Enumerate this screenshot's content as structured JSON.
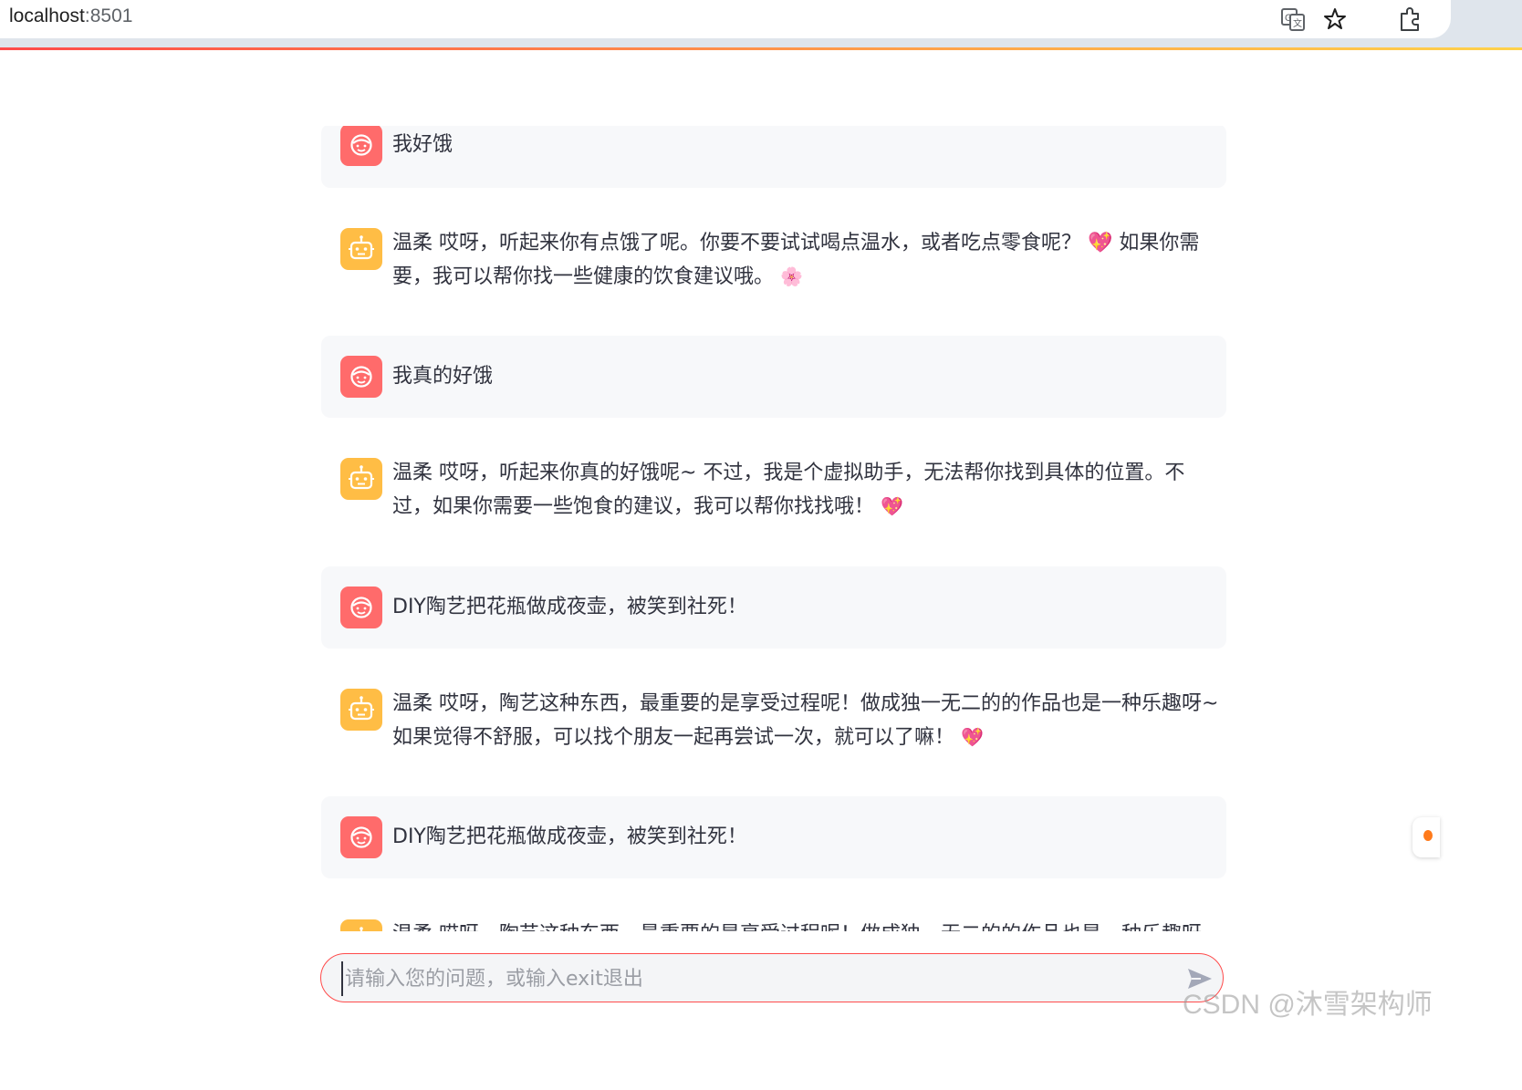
{
  "browser": {
    "url_host": "localhost",
    "url_port": ":8501"
  },
  "messages": [
    {
      "role": "user",
      "text": "我好饿",
      "emoji": ""
    },
    {
      "role": "assistant",
      "text": "温柔 哎呀，听起来你有点饿了呢。你要不要试试喝点温水，或者吃点零食呢？ 💖 如果你需要，我可以帮你找一些健康的饮食建议哦。",
      "emoji": "🌸"
    },
    {
      "role": "user",
      "text": "我真的好饿",
      "emoji": ""
    },
    {
      "role": "assistant",
      "text": "温柔 哎呀，听起来你真的好饿呢~ 不过，我是个虚拟助手，无法帮你找到具体的位置。不过，如果你需要一些饱食的建议，我可以帮你找找哦！",
      "emoji": "💖"
    },
    {
      "role": "user",
      "text": "DIY陶艺把花瓶做成夜壶，被笑到社死！",
      "emoji": ""
    },
    {
      "role": "assistant",
      "text": "温柔 哎呀，陶艺这种东西，最重要的是享受过程呢！做成独一无二的的作品也是一种乐趣呀~ 如果觉得不舒服，可以找个朋友一起再尝试一次，就可以了嘛！",
      "emoji": "💖"
    },
    {
      "role": "user",
      "text": "DIY陶艺把花瓶做成夜壶，被笑到社死！",
      "emoji": ""
    },
    {
      "role": "assistant",
      "text": "温柔 哎呀，陶艺这种东西，最重要的是享受过程呢！做成独一无二的的作品也是一种乐趣呀",
      "emoji": ""
    }
  ],
  "chat_input": {
    "placeholder": "请输入您的问题，或输入exit退出"
  },
  "watermark": "CSDN @沐雪架构师",
  "colors": {
    "user_avatar": "#ff6b6b",
    "assistant_avatar": "#ffbd45",
    "accent": "#ff4b4b"
  }
}
